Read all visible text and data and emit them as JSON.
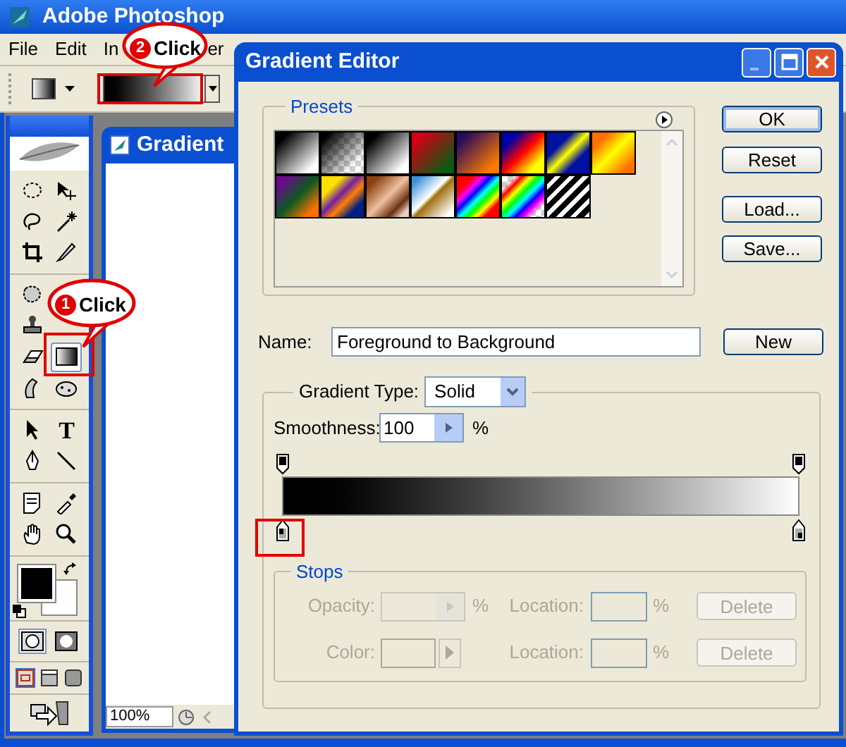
{
  "app": {
    "title": "Adobe Photoshop",
    "menu": [
      {
        "label": "File"
      },
      {
        "label": "Edit"
      },
      {
        "label": "In"
      },
      {
        "label": "er"
      }
    ]
  },
  "toolbox": {
    "groups": [
      [
        {
          "left": {
            "kind": "marquee",
            "selected": false
          },
          "right": {
            "kind": "move",
            "selected": false
          }
        },
        {
          "left": {
            "kind": "lasso",
            "selected": false
          },
          "right": {
            "kind": "wand",
            "selected": false
          }
        },
        {
          "left": {
            "kind": "crop",
            "selected": false
          },
          "right": {
            "kind": "slice",
            "selected": false
          }
        }
      ],
      [
        {
          "left": {
            "kind": "patch",
            "selected": false
          }
        },
        {
          "left": {
            "kind": "stamp",
            "selected": false
          }
        },
        {
          "left": {
            "kind": "eraser",
            "selected": false
          },
          "right": {
            "kind": "gradient",
            "selected": true
          }
        },
        {
          "left": {
            "kind": "smudge",
            "selected": false
          },
          "right": {
            "kind": "sponge",
            "selected": false
          }
        }
      ],
      [
        {
          "left": {
            "kind": "path_select",
            "selected": false
          },
          "right": {
            "kind": "type",
            "selected": false,
            "glyph": "T"
          }
        },
        {
          "left": {
            "kind": "pen",
            "selected": false
          },
          "right": {
            "kind": "line",
            "selected": false
          }
        }
      ],
      [
        {
          "left": {
            "kind": "notes",
            "selected": false
          },
          "right": {
            "kind": "eyedropper",
            "selected": false
          }
        },
        {
          "left": {
            "kind": "hand",
            "selected": false
          },
          "right": {
            "kind": "zoom",
            "selected": false
          }
        }
      ]
    ],
    "mask_modes": [
      {
        "selected": true
      },
      {
        "selected": false
      }
    ],
    "screen_modes": [
      {
        "selected": true
      },
      {
        "selected": false
      },
      {
        "selected": false
      }
    ]
  },
  "document": {
    "title": "Gradient",
    "zoom": "100%"
  },
  "callouts": [
    {
      "number": "1",
      "label": "Click"
    },
    {
      "number": "2",
      "label": "Click"
    }
  ],
  "dialog": {
    "title": "Gradient Editor",
    "presets": {
      "label": "Presets"
    },
    "buttons": [
      {
        "label": "OK",
        "default": true
      },
      {
        "label": "Reset",
        "default": false
      },
      {
        "label": "Load...",
        "default": false
      },
      {
        "label": "Save...",
        "default": false
      }
    ],
    "name": {
      "label": "Name:",
      "value": "Foreground to Background"
    },
    "new_button": "New",
    "gradient_type": {
      "label": "Gradient Type:",
      "value": "Solid"
    },
    "smoothness": {
      "label": "Smoothness:",
      "value": "100",
      "unit": "%"
    },
    "stops": {
      "label": "Stops",
      "rows": [
        {
          "kind": "opacity",
          "label": "Opacity:",
          "unit": "%",
          "location_label": "Location:",
          "location_unit": "%",
          "button": "Delete",
          "disabled": true
        },
        {
          "kind": "color",
          "label": "Color:",
          "location_label": "Location:",
          "location_unit": "%",
          "button": "Delete",
          "disabled": true
        }
      ]
    }
  }
}
